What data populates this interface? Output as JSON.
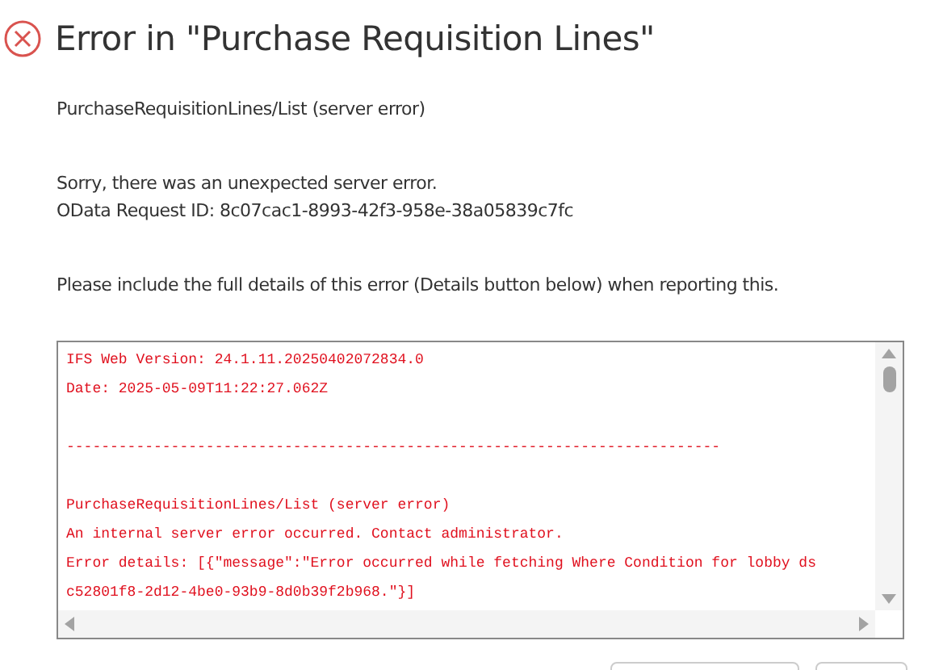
{
  "dialog": {
    "title": "Error in \"Purchase Requisition Lines\"",
    "source": "PurchaseRequisitionLines/List (server error)",
    "message_lines": [
      "Sorry, there was an unexpected server error.",
      "OData Request ID: 8c07cac1-8993-42f3-958e-38a05839c7fc"
    ],
    "instruction": "Please include the full details of this error (Details button below) when reporting this.",
    "details_blocks": [
      [
        "IFS Web Version: 24.1.11.20250402072834.0",
        "Date: 2025-05-09T11:22:27.062Z"
      ],
      [
        "---------------------------------------------------------------------------"
      ],
      [
        "PurchaseRequisitionLines/List (server error)",
        "An internal server error occurred. Contact administrator.",
        "Error details: [{\"message\":\"Error occurred while fetching Where Condition for lobby ds",
        "c52801f8-2d12-4be0-93b9-8d0b39f2b968.\"}]"
      ]
    ]
  }
}
